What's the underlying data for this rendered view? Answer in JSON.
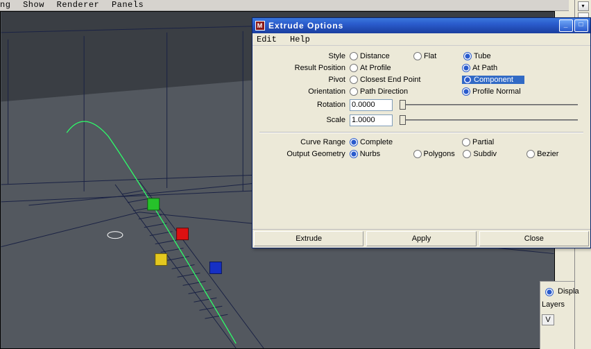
{
  "main_menu": {
    "items": [
      "ng",
      "Show",
      "Renderer",
      "Panels"
    ]
  },
  "dialog": {
    "title": "Extrude Options",
    "menu": {
      "edit": "Edit",
      "help": "Help"
    },
    "labels": {
      "style": "Style",
      "result_position": "Result Position",
      "pivot": "Pivot",
      "orientation": "Orientation",
      "rotation": "Rotation",
      "scale": "Scale",
      "curve_range": "Curve Range",
      "output_geometry": "Output Geometry"
    },
    "style": {
      "distance": "Distance",
      "flat": "Flat",
      "tube": "Tube",
      "selected": "tube"
    },
    "result_position": {
      "at_profile": "At Profile",
      "at_path": "At Path",
      "selected": "at_path"
    },
    "pivot": {
      "closest_end_point": "Closest End Point",
      "component": "Component",
      "selected": "component"
    },
    "orientation": {
      "path_direction": "Path Direction",
      "profile_normal": "Profile Normal",
      "selected": "profile_normal"
    },
    "rotation": "0.0000",
    "scale": "1.0000",
    "curve_range": {
      "complete": "Complete",
      "partial": "Partial",
      "selected": "complete"
    },
    "output_geometry": {
      "nurbs": "Nurbs",
      "polygons": "Polygons",
      "subdiv": "Subdiv",
      "bezier": "Bezier",
      "selected": "nurbs"
    },
    "buttons": {
      "extrude": "Extrude",
      "apply": "Apply",
      "close": "Close"
    }
  },
  "side_panel": {
    "display": "Displa",
    "layers": "Layers",
    "v_btn": "V"
  }
}
